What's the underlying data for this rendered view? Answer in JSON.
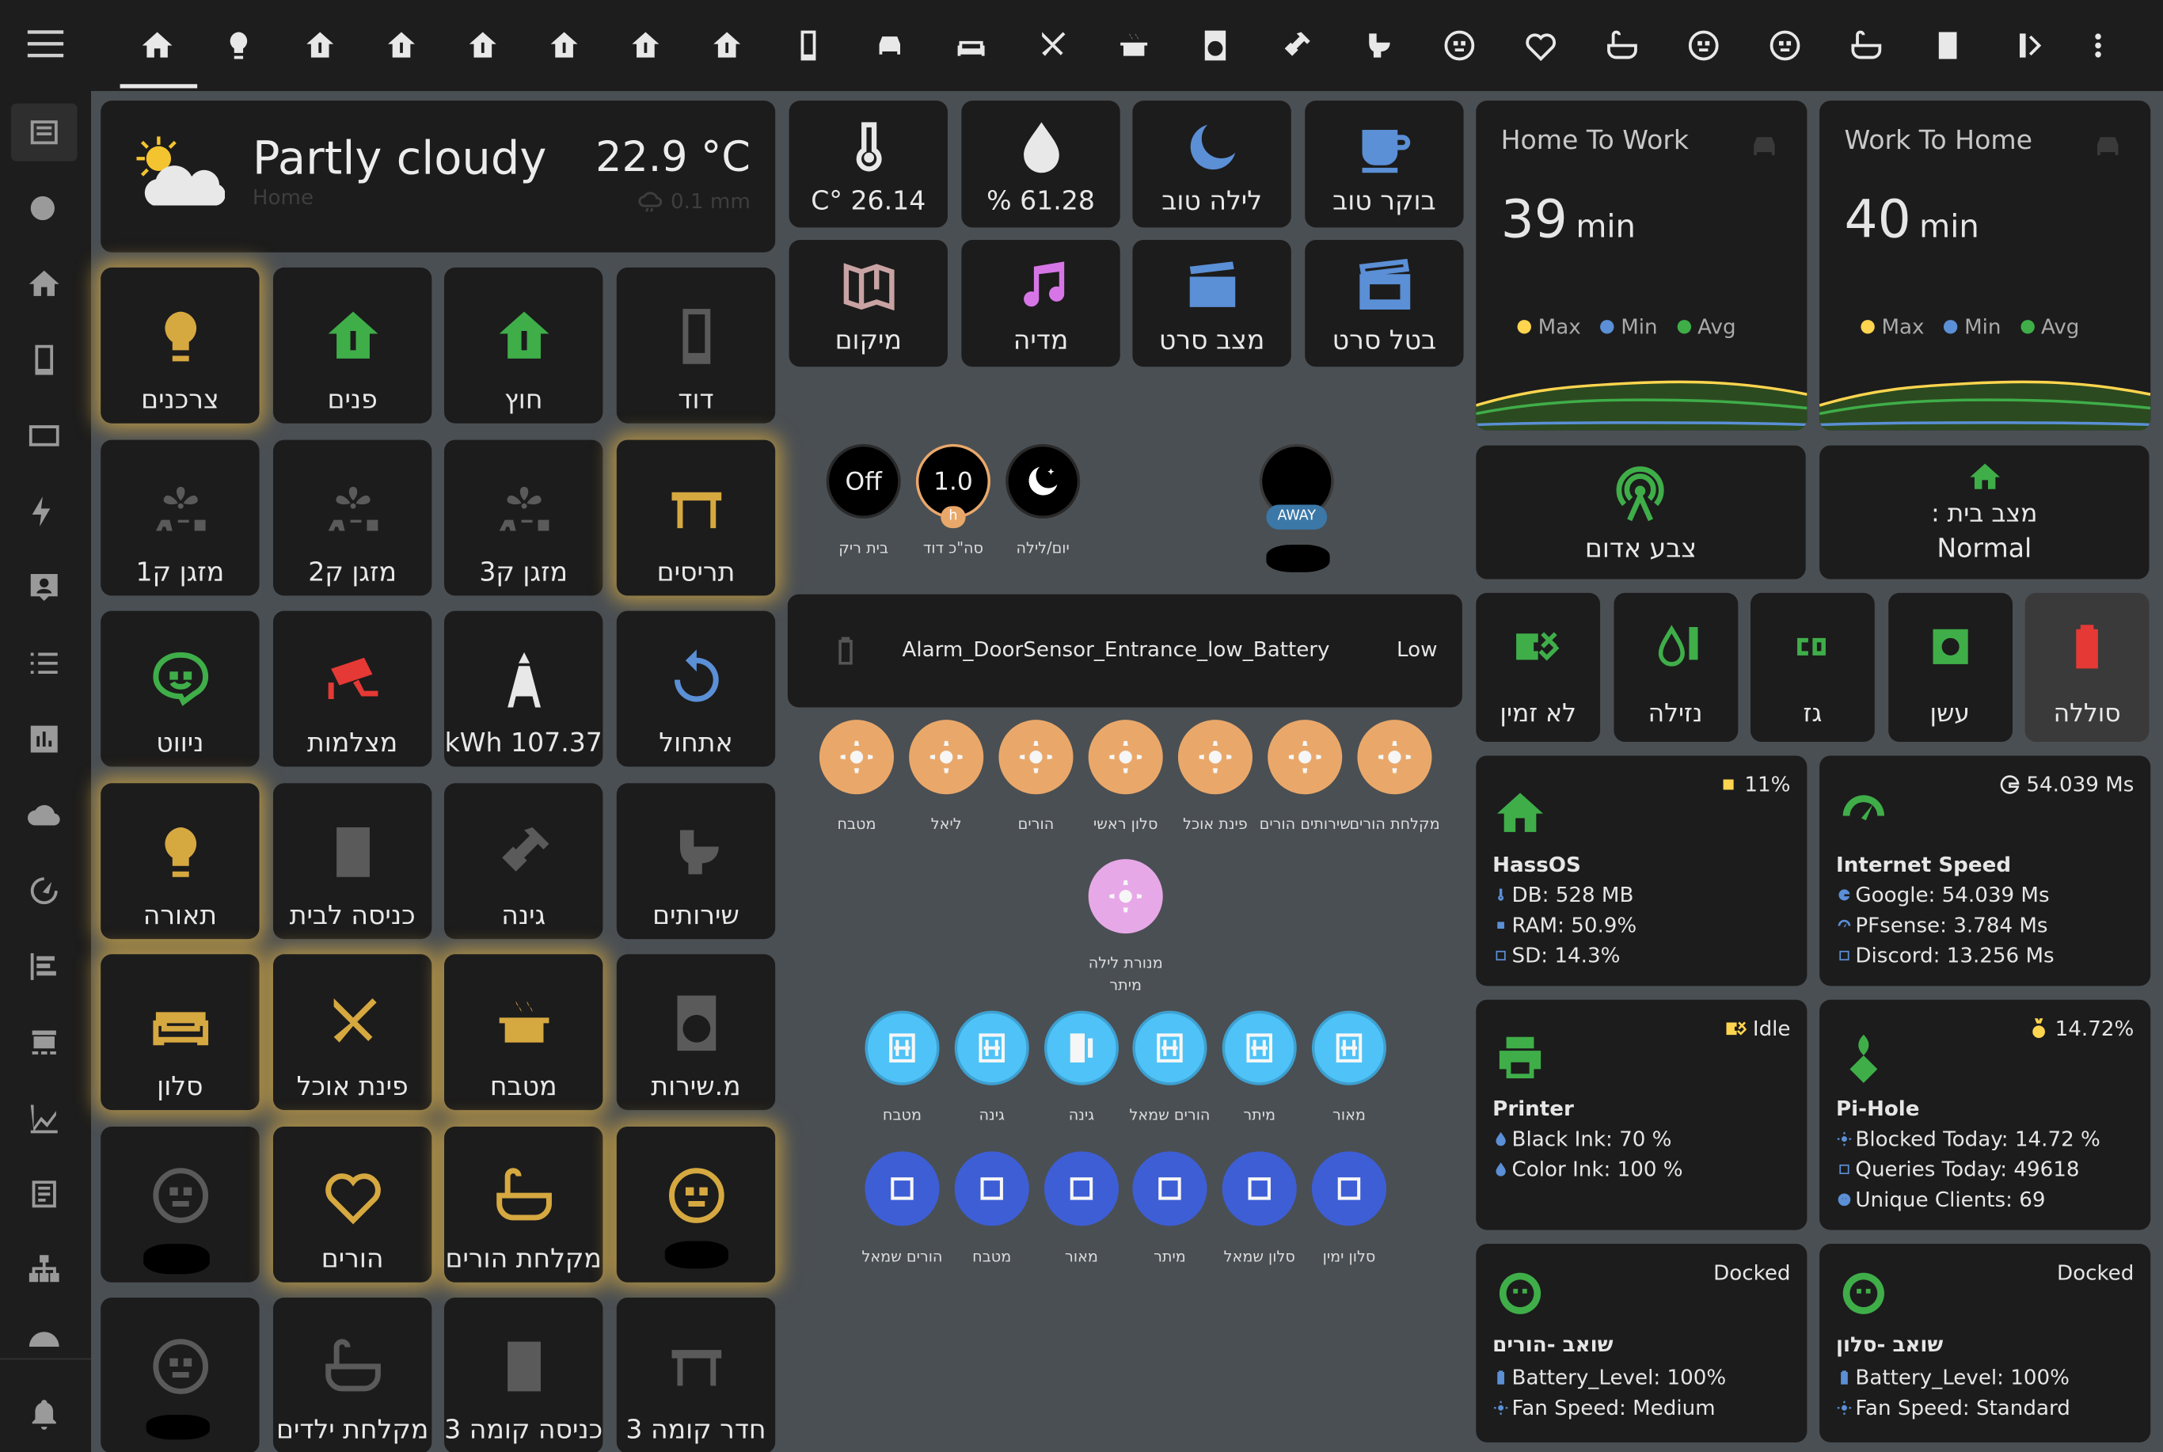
{
  "weather": {
    "condition": "Partly cloudy",
    "location": "Home",
    "temperature": "22.9 °C",
    "precipitation": "0.1 mm"
  },
  "sensors": [
    {
      "value": "26.14 °C",
      "icon": "home-thermometer-icon"
    },
    {
      "value": "61.28 %",
      "icon": "water-percent-icon"
    },
    {
      "value": "לילה טוב",
      "icon": "weather-night-icon"
    },
    {
      "value": "בוקר טוב",
      "icon": "coffee-icon"
    },
    {
      "value": "מיקום",
      "icon": "map-search-icon"
    },
    {
      "value": "מדיה",
      "icon": "music-note-icon"
    },
    {
      "value": "מצב סרט",
      "icon": "movie-icon"
    },
    {
      "value": "בטל סרט",
      "icon": "movie-off-icon"
    }
  ],
  "tiles": [
    [
      "צרכנים",
      "פנים",
      "חוץ",
      "דוד"
    ],
    [
      "מזגן ק1",
      "מזגן ק2",
      "מזגן ק3",
      "תריסים"
    ],
    [
      "ניווט",
      "מצלמות",
      "107.37 kWh",
      "אתחול"
    ],
    [
      "תאורה",
      "כניסה לבית",
      "גינה",
      "שירותים"
    ],
    [
      "סלון",
      "פינת אוכל",
      "מטבח",
      "מ.שירות"
    ],
    [
      "",
      "הורים",
      "מקלחת הורים",
      ""
    ],
    [
      "",
      "מקלחת ילדים",
      "כניסה קומה 3",
      "חדר קומה 3"
    ]
  ],
  "status_buttons": [
    {
      "value": "Off",
      "label": "בית ריק"
    },
    {
      "value": "1.0",
      "badge": "h",
      "label": "סה\"כ דוד"
    },
    {
      "value": "",
      "label": "יום/לילה"
    }
  ],
  "person": {
    "badge": "AWAY"
  },
  "alarm": {
    "name": "Alarm_DoorSensor_Entrance_low_Battery",
    "state": "Low"
  },
  "lights_row1": [
    "מטבח",
    "ליאל",
    "הורים",
    "סלון ראשי",
    "פינת אוכל",
    "שירותים הורים",
    "מקלחת הורים"
  ],
  "lights_row2": [
    "מנורת לילה מיתר"
  ],
  "covers_row1": [
    "מטבח",
    "גינה",
    "גינה",
    "הורים שמאל",
    "מיתר",
    "מאור"
  ],
  "covers_row2": [
    "הורים שמאל",
    "מטבח",
    "מאור",
    "מיתר",
    "סלון שמאל",
    "סלון ימין"
  ],
  "travel": [
    {
      "title": "Home To Work",
      "value": "39",
      "unit": "min",
      "legend": [
        "Max",
        "Min",
        "Avg"
      ]
    },
    {
      "title": "Work To Home",
      "value": "40",
      "unit": "min",
      "legend": [
        "Max",
        "Min",
        "Avg"
      ]
    }
  ],
  "mode_cards": [
    {
      "label": "צבע אדום"
    },
    {
      "label": "מצב בית :",
      "value": "Normal"
    }
  ],
  "alerts": [
    "לא זמין",
    "נזילה",
    "גז",
    "עשן",
    "סוללה"
  ],
  "hassos": {
    "badge": "11%",
    "title": "HassOS",
    "rows": [
      "DB: 528 MB",
      "RAM: 50.9%",
      "SD: 14.3%"
    ]
  },
  "internet": {
    "badge": "54.039 Ms",
    "title": "Internet Speed",
    "rows": [
      "Google: 54.039 Ms",
      "PFsense: 3.784 Ms",
      "Discord: 13.256 Ms"
    ]
  },
  "printer": {
    "badge": "Idle",
    "title": "Printer",
    "rows": [
      "Black Ink: 70 %",
      "Color Ink: 100 %"
    ]
  },
  "pihole": {
    "badge": "14.72%",
    "title": "Pi-Hole",
    "rows": [
      "Blocked Today: 14.72 %",
      "Queries Today: 49618",
      "Unique Clients: 69"
    ]
  },
  "vac1": {
    "badge": "Docked",
    "title": "שואב -הורים",
    "rows": [
      "Battery_Level: 100%",
      "Fan Speed: Medium"
    ]
  },
  "vac2": {
    "badge": "Docked",
    "title": "שואב -סלון",
    "rows": [
      "Battery_Level: 100%",
      "Fan Speed: Standard"
    ]
  },
  "colors": {
    "accent_gold": "#d6a840",
    "green": "#3fae49",
    "red": "#e53935",
    "orange": "#e9a86a",
    "cover_teal": "#4fc3f7",
    "cover_blue": "#3e5ed6",
    "yellow": "#ffd54f"
  }
}
